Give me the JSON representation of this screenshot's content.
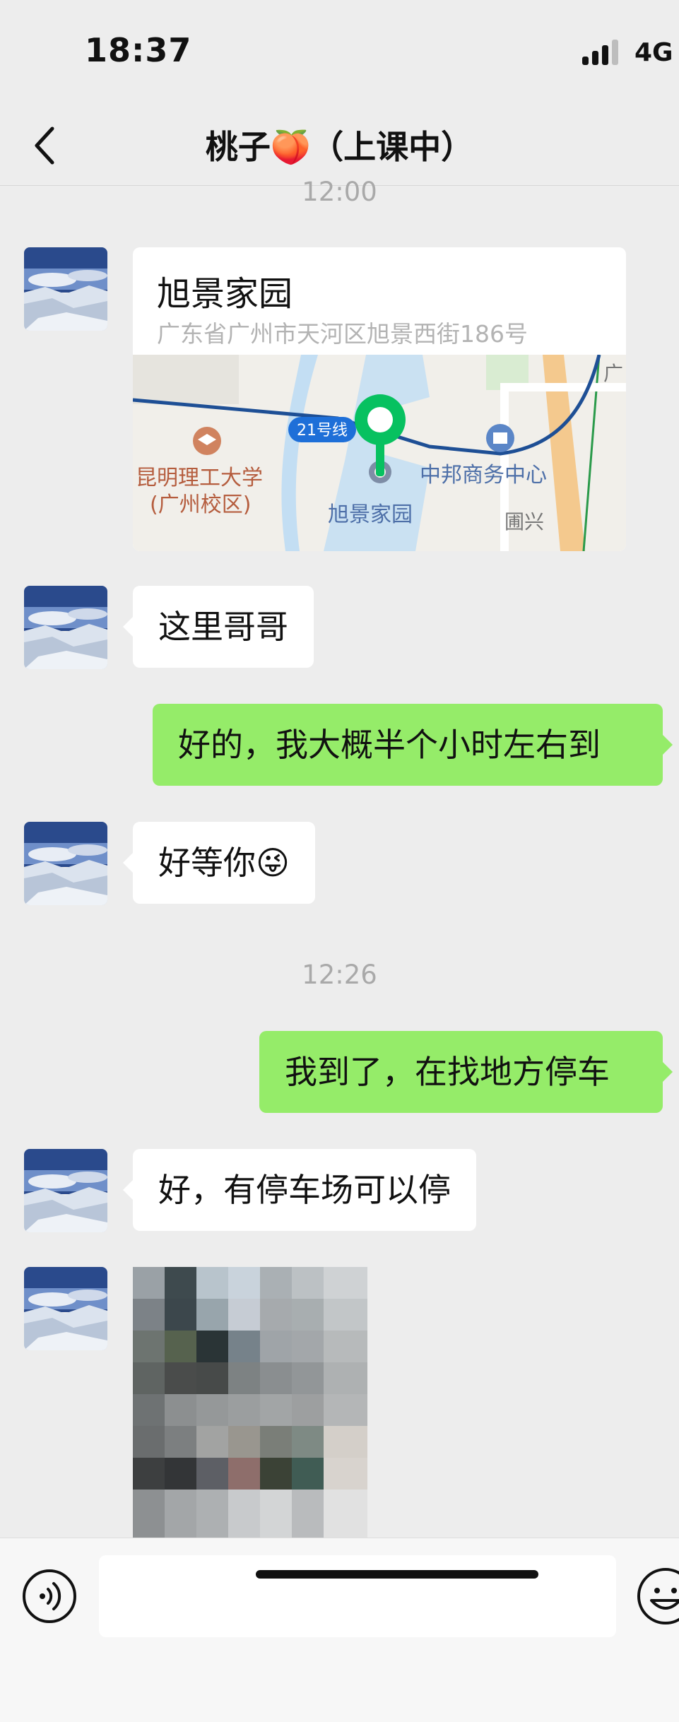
{
  "status_bar": {
    "time": "18:37",
    "network": "4G"
  },
  "header": {
    "title": "桃子🍑（上课中）",
    "back_icon": "chevron-left-icon"
  },
  "timestamps": [
    "12:00",
    "12:26"
  ],
  "location_message": {
    "name": "旭景家园",
    "address": "广东省广州市天河区旭景西街186号",
    "map_labels": {
      "line": "21号线",
      "university": "昆明理工大学",
      "campus": "(广州校区)",
      "pin_place": "旭景家园",
      "business": "中邦商务中心",
      "street": "圃兴",
      "corner": "广"
    }
  },
  "messages": [
    {
      "side": "left",
      "text": "这里哥哥"
    },
    {
      "side": "right",
      "text": "好的，我大概半个小时左右到"
    },
    {
      "side": "left",
      "text": "好等你😜"
    },
    {
      "side": "right",
      "text": "我到了，在找地方停车"
    },
    {
      "side": "left",
      "text": "好，有停车场可以停"
    }
  ],
  "image_message": {
    "description_icon": "blurred-photo-icon"
  },
  "input_bar": {
    "voice_icon": "voice-icon",
    "emoji_icon": "emoji-icon"
  },
  "colors": {
    "sent_bubble": "#95ec69",
    "received_bubble": "#ffffff",
    "background": "#ededed",
    "pin": "#07c160"
  }
}
